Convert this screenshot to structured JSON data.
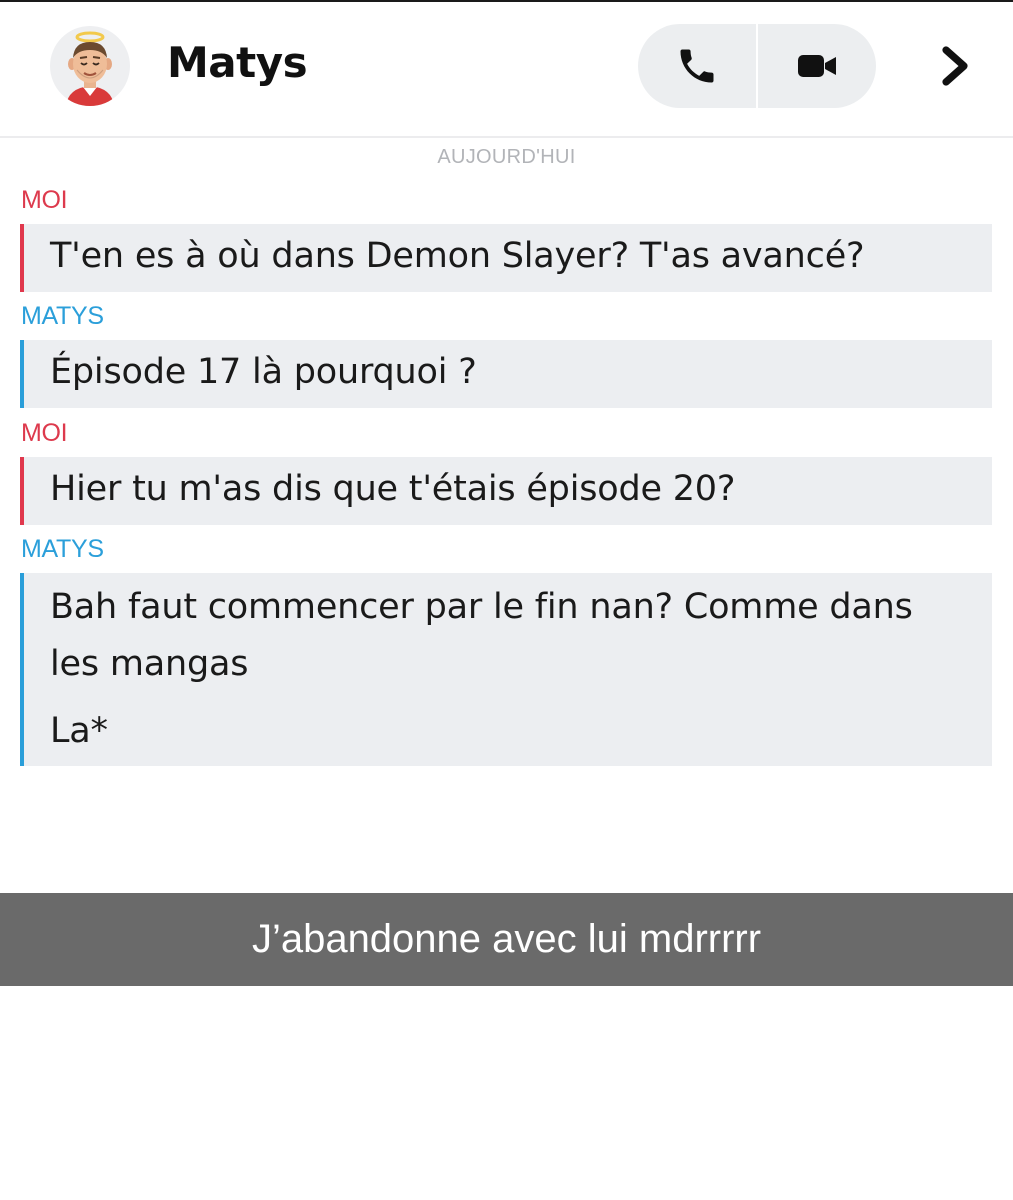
{
  "header": {
    "contact_name": "Matys",
    "avatar_icon": "bitmoji-avatar-icon",
    "voice_call_icon": "phone-icon",
    "video_call_icon": "video-camera-icon",
    "details_icon": "chevron-right-icon"
  },
  "chat": {
    "date_label": "AUJOURD'HUI",
    "messages": [
      {
        "sender": "MOI",
        "lines": [
          "T'en es à où dans Demon Slayer? T'as avancé?"
        ]
      },
      {
        "sender": "MATYS",
        "lines": [
          "Épisode 17 là pourquoi ?"
        ]
      },
      {
        "sender": "MOI",
        "lines": [
          "Hier tu m'as dis que t'étais épisode 20?"
        ]
      },
      {
        "sender": "MATYS",
        "lines": [
          "Bah faut commencer par le fin nan? Comme dans",
          "les mangas",
          "La*"
        ]
      }
    ]
  },
  "caption": {
    "text": "J’abandonne avec lui mdrrrrr"
  },
  "colors": {
    "me": "#dd3a4d",
    "them": "#2b9fda",
    "bubble_bg": "#eceef1",
    "caption_bg": "#6a6a6a"
  }
}
